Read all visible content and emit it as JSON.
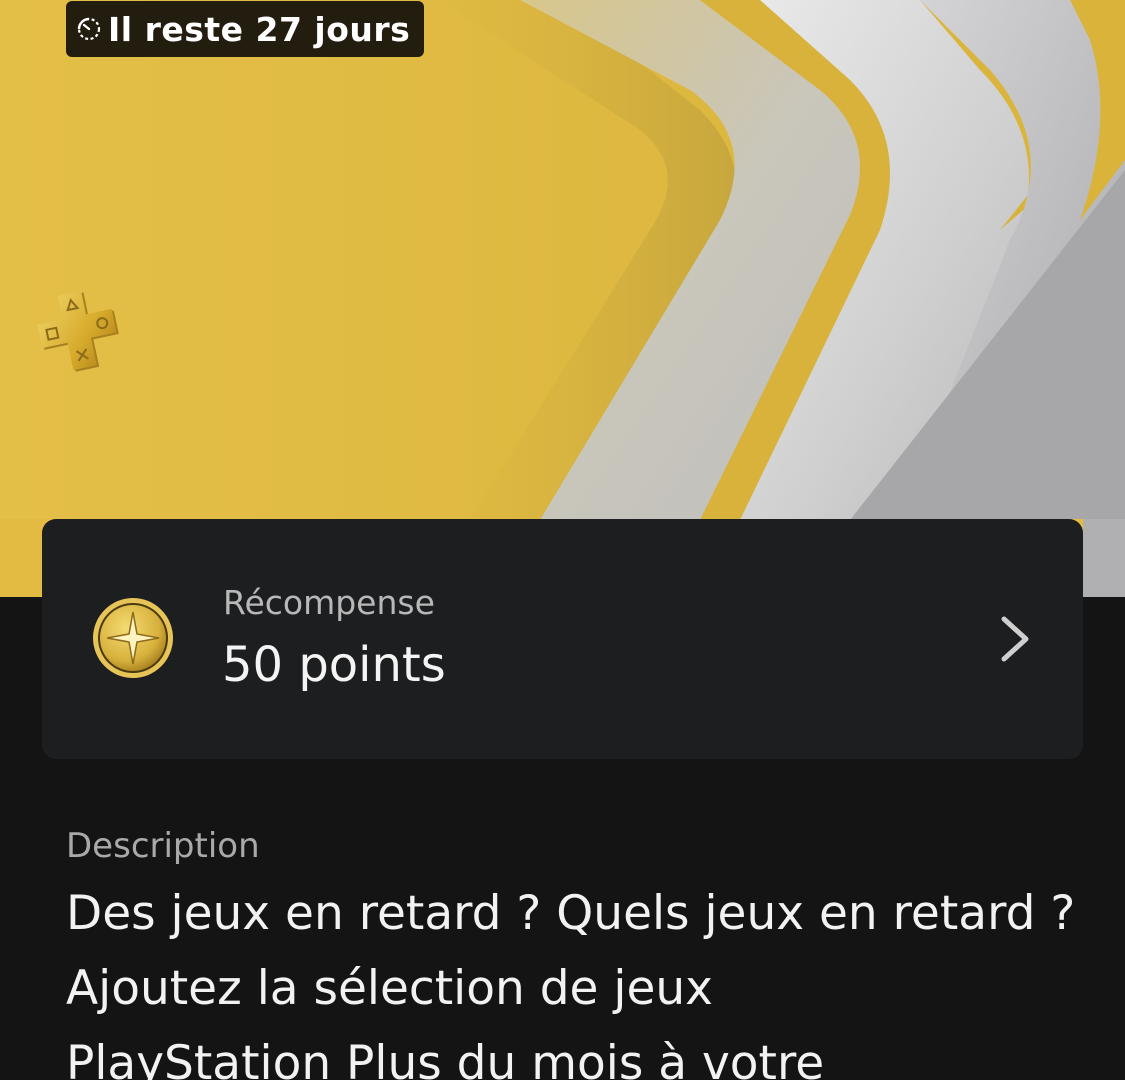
{
  "hero": {
    "timer_text": "Il reste 27 jours",
    "timer_icon": "timer-icon",
    "logo_icon": "playstation-plus-logo",
    "colors": {
      "background": "#e3bb43",
      "silver": "#c8c8c8",
      "badge": "#231d10"
    }
  },
  "reward": {
    "label": "Récompense",
    "value": "50 points",
    "icon": "gold-star-coin-icon",
    "chevron": "chevron-right-icon"
  },
  "description": {
    "label": "Description",
    "text": "Des jeux en retard ? Quels jeux en retard ?\nAjoutez la sélection de jeux\nPlayStation Plus du mois à votre"
  }
}
